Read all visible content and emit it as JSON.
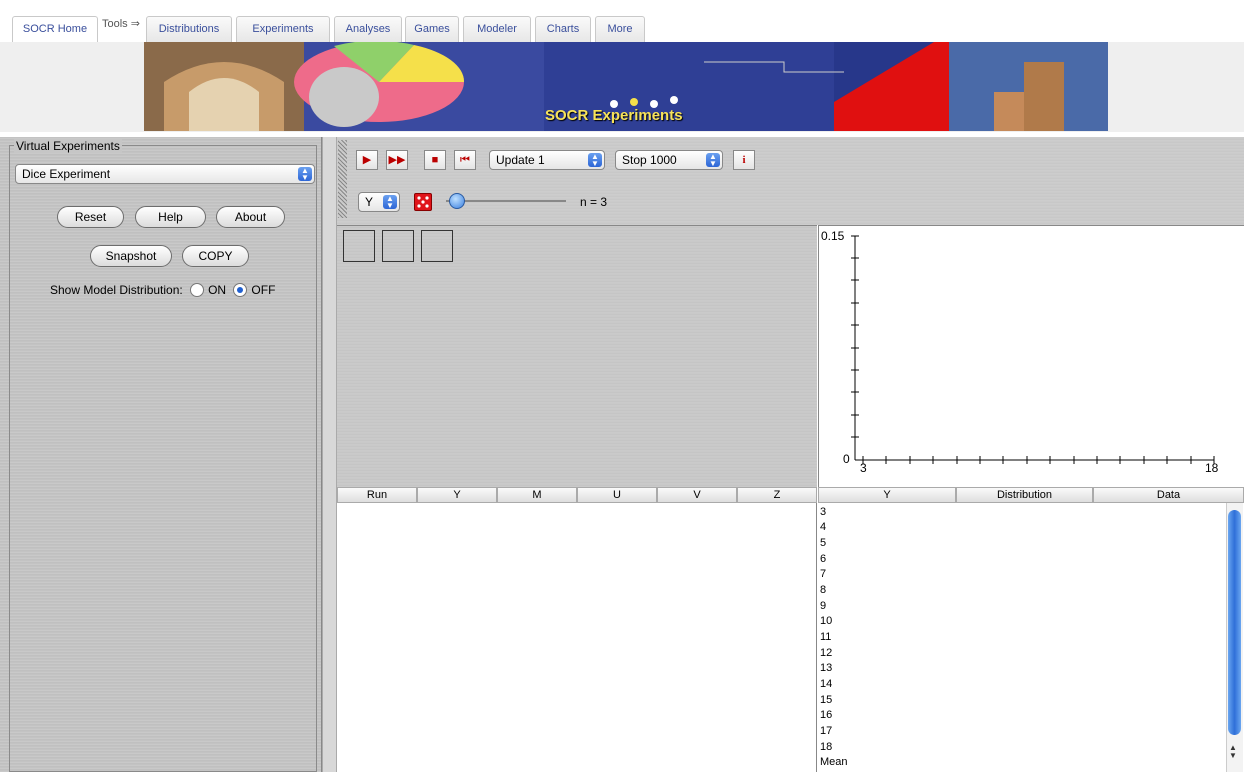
{
  "tabs": {
    "home": "SOCR Home",
    "tools": "Tools ⇒",
    "distributions": "Distributions",
    "experiments": "Experiments",
    "analyses": "Analyses",
    "games": "Games",
    "modeler": "Modeler",
    "charts": "Charts",
    "more": "More"
  },
  "banner": {
    "title": "SOCR Experiments"
  },
  "left_panel": {
    "legend": "Virtual Experiments",
    "experiment_select": "Dice Experiment",
    "buttons": {
      "reset": "Reset",
      "help": "Help",
      "about": "About",
      "snapshot": "Snapshot",
      "copy": "COPY"
    },
    "model_dist_label": "Show Model Distribution:",
    "radio_on": "ON",
    "radio_off": "OFF",
    "radio_selected": "OFF"
  },
  "toolbar": {
    "play_icon": "▶",
    "fast_icon": "▶▶",
    "stop_icon": "■",
    "reset_icon": "⏮",
    "update_select": "Update 1",
    "stop_select": "Stop 1000",
    "info_icon": "i",
    "variable_select": "Y",
    "n_label": "n = 3",
    "slider_value": 3
  },
  "graph": {
    "y_max_label": "0.15",
    "y_min_label": "0",
    "x_min_label": "3",
    "x_max_label": "18"
  },
  "left_table": {
    "columns": [
      "Run",
      "Y",
      "M",
      "U",
      "V",
      "Z"
    ]
  },
  "right_table": {
    "columns": [
      "Y",
      "Distribution",
      "Data"
    ],
    "rows": [
      "3",
      "4",
      "5",
      "6",
      "7",
      "8",
      "9",
      "10",
      "11",
      "12",
      "13",
      "14",
      "15",
      "16",
      "17",
      "18",
      "Mean"
    ]
  }
}
